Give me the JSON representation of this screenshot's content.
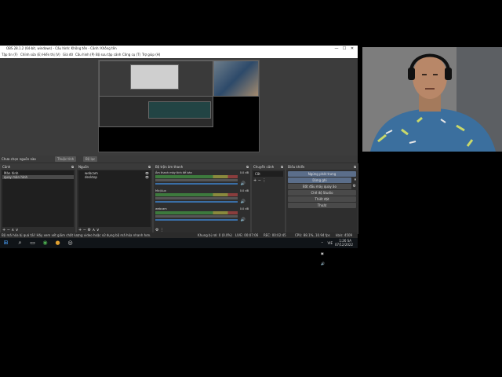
{
  "window": {
    "title": "OBS 28.1.2 (64-bit, windows) - Cấu hình: Không tên - Cảnh: Không tên",
    "controls": [
      "—",
      "☐",
      "✕"
    ]
  },
  "menu": [
    "Tập tin (F)",
    "Chỉnh sửa (E)",
    "Hiển thị (V)",
    "Giá đỡ",
    "Cấu hình (P)",
    "Bộ sưu tập cảnh",
    "Công cụ (T)",
    "Trợ giúp (H)"
  ],
  "source_toolbar": {
    "status": "Chưa chọn nguồn nào",
    "properties_label": "Thuộc tính",
    "filters_label": "Bộ lọc"
  },
  "docks": {
    "scenes": {
      "title": "Cảnh",
      "items": [
        "Màn hình",
        "quay màn hình"
      ],
      "footer": "+ −  ∧ ∨"
    },
    "sources": {
      "title": "Nguồn",
      "items": [
        "webcam",
        "desktop"
      ],
      "footer": "+ −  ⚙  ∧ ∨"
    },
    "mixer": {
      "title": "Bộ trộn âm thanh",
      "channels": [
        {
          "name": "Âm thanh máy tính để bàn",
          "db": "0.0 dB"
        },
        {
          "name": "Mic/Aux",
          "db": "0.0 dB"
        },
        {
          "name": "webcam",
          "db": "0.0 dB"
        }
      ],
      "footer": "⚙  ⋮"
    },
    "transitions": {
      "title": "Chuyển cảnh",
      "type": "Cắt",
      "footer": "+  −  ⋮"
    },
    "controls": {
      "title": "Điều khiển",
      "buttons": [
        "Ngừng phát trưng",
        "Dừng ghi",
        "Bắt đầu máy quay ảo",
        "Chế độ Studio",
        "Thiết đặt",
        "Thoát"
      ]
    }
  },
  "status": {
    "message": "Bộ mã hóa bị quá tải! Hãy xem xét giảm chất lượng video hoặc sử dụng bộ mã hóa nhanh hơn.",
    "dropped": "Khung bị rơi: 0 (0.0%)",
    "live": "LIVE: 00:07:06",
    "rec": "REC: 00:02:45",
    "cpu": "CPU: 88.1%, 10.94 fps",
    "kbps": "kb/s: 4509"
  },
  "taskbar": {
    "time": "1:26 SA",
    "date": "07/12/2022",
    "lang": "VIE"
  },
  "colors": {
    "accent": "#3a6ea5",
    "meter_green": "#3d7a3d",
    "meter_yellow": "#8a8a3d",
    "meter_red": "#8a3d3d"
  }
}
